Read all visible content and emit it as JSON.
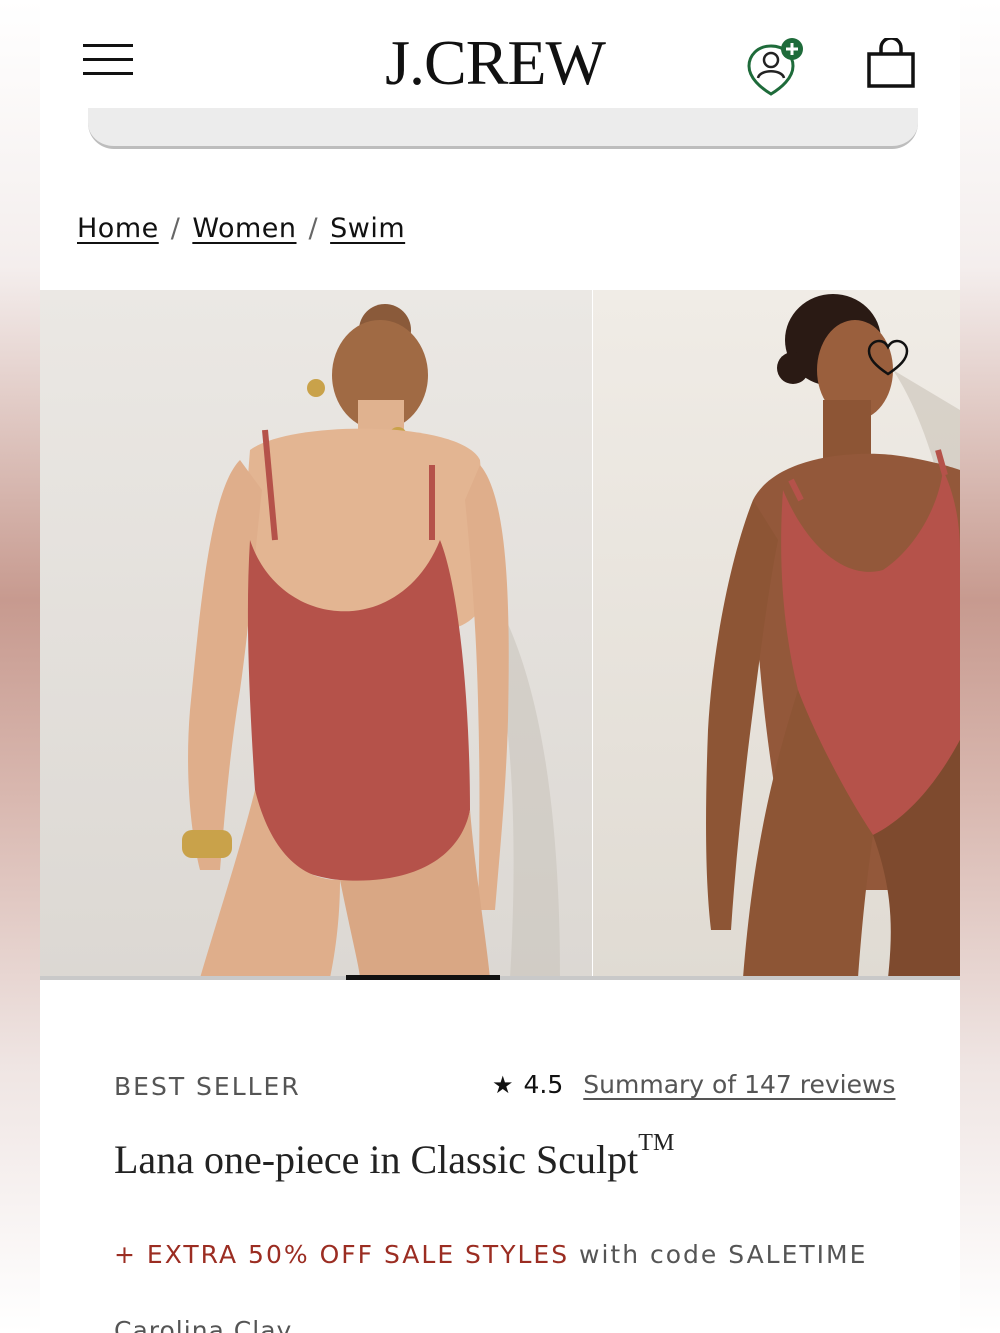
{
  "header": {
    "logo": "J.CREW",
    "menu_icon": "hamburger-menu-icon",
    "account_icon": "account-add-icon",
    "bag_icon": "shopping-bag-icon"
  },
  "breadcrumb": {
    "items": [
      "Home",
      "Women",
      "Swim"
    ],
    "separator": "/"
  },
  "gallery": {
    "images": [
      "product-back-view",
      "product-front-view"
    ],
    "wishlist_icon": "heart-icon"
  },
  "product": {
    "badge": "BEST SELLER",
    "rating": "4.5",
    "reviews_link": "Summary of 147 reviews",
    "title": "Lana one-piece in Classic Sculpt",
    "title_mark": "TM",
    "promo_accent": "+ EXTRA 50% OFF SALE STYLES",
    "promo_rest": " with code SALETIME",
    "color_partial": "Carolina Clay"
  },
  "colors": {
    "accent": "#9b2d22",
    "account_green": "#1e6b3a",
    "swimsuit": "#b5524a"
  }
}
